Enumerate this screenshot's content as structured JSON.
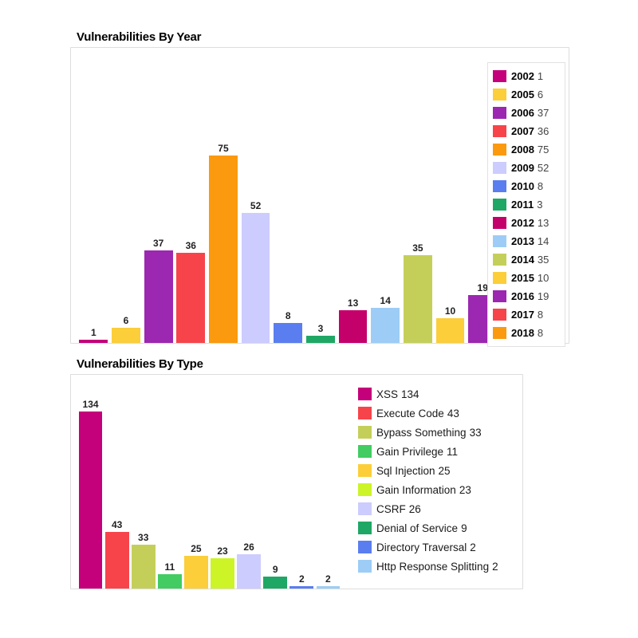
{
  "charts": [
    {
      "title": "Vulnerabilities By Year",
      "legend_style": "boxed",
      "legend_items": [
        {
          "key": "2002",
          "value": "1",
          "color": "#c4007a"
        },
        {
          "key": "2005",
          "value": "6",
          "color": "#fbce3a"
        },
        {
          "key": "2006",
          "value": "37",
          "color": "#9c27b0"
        },
        {
          "key": "2007",
          "value": "36",
          "color": "#f7444a"
        },
        {
          "key": "2008",
          "value": "75",
          "color": "#fb9a0e"
        },
        {
          "key": "2009",
          "value": "52",
          "color": "#ccccff"
        },
        {
          "key": "2010",
          "value": "8",
          "color": "#5a7ef0"
        },
        {
          "key": "2011",
          "value": "3",
          "color": "#1fa765"
        },
        {
          "key": "2012",
          "value": "13",
          "color": "#c4006b"
        },
        {
          "key": "2013",
          "value": "14",
          "color": "#9dcdf6"
        },
        {
          "key": "2014",
          "value": "35",
          "color": "#c4cf5a"
        },
        {
          "key": "2015",
          "value": "10",
          "color": "#fbce3a"
        },
        {
          "key": "2016",
          "value": "19",
          "color": "#9c27b0"
        },
        {
          "key": "2017",
          "value": "8",
          "color": "#f7444a"
        },
        {
          "key": "2018",
          "value": "8",
          "color": "#fb9a0e"
        }
      ]
    },
    {
      "title": "Vulnerabilities By Type",
      "legend_style": "plain",
      "legend_items": [
        {
          "key": "XSS",
          "value": "134",
          "color": "#c4007a"
        },
        {
          "key": "Execute Code",
          "value": "43",
          "color": "#f7444a"
        },
        {
          "key": "Bypass Something",
          "value": "33",
          "color": "#c4cf5a"
        },
        {
          "key": "Gain Privilege",
          "value": "11",
          "color": "#42cc62"
        },
        {
          "key": "Sql Injection",
          "value": "25",
          "color": "#fbce3a"
        },
        {
          "key": "Gain Information",
          "value": "23",
          "color": "#ccf427"
        },
        {
          "key": "CSRF",
          "value": "26",
          "color": "#ccccff"
        },
        {
          "key": "Denial of Service",
          "value": "9",
          "color": "#1fa765"
        },
        {
          "key": "Directory Traversal",
          "value": "2",
          "color": "#5a7ef0"
        },
        {
          "key": "Http Response Splitting",
          "value": "2",
          "color": "#9dcdf6"
        }
      ]
    }
  ],
  "chart_data": [
    {
      "type": "bar",
      "title": "Vulnerabilities By Year",
      "xlabel": "",
      "ylabel": "",
      "grid": false,
      "legend_position": "right",
      "ylim": [
        0,
        75
      ],
      "categories": [
        "2002",
        "2005",
        "2006",
        "2007",
        "2008",
        "2009",
        "2010",
        "2011",
        "2012",
        "2013",
        "2014",
        "2015",
        "2016",
        "2017",
        "2018"
      ],
      "values": [
        1,
        6,
        37,
        36,
        75,
        52,
        8,
        3,
        13,
        14,
        35,
        10,
        19,
        8,
        8
      ],
      "colors": [
        "#c4007a",
        "#fbce3a",
        "#9c27b0",
        "#f7444a",
        "#fb9a0e",
        "#ccccff",
        "#5a7ef0",
        "#1fa765",
        "#c4006b",
        "#9dcdf6",
        "#c4cf5a",
        "#fbce3a",
        "#9c27b0",
        "#f7444a",
        "#fb9a0e"
      ],
      "data_labels": [
        "1",
        "6",
        "37",
        "36",
        "75",
        "52",
        "8",
        "3",
        "13",
        "14",
        "35",
        "10",
        "19",
        "8",
        "8"
      ]
    },
    {
      "type": "bar",
      "title": "Vulnerabilities By Type",
      "xlabel": "",
      "ylabel": "",
      "grid": false,
      "legend_position": "right",
      "ylim": [
        0,
        134
      ],
      "categories": [
        "XSS",
        "Execute Code",
        "Bypass Something",
        "Gain Privilege",
        "Sql Injection",
        "Gain Information",
        "CSRF",
        "Denial of Service",
        "Directory Traversal",
        "Http Response Splitting"
      ],
      "values": [
        134,
        43,
        33,
        11,
        25,
        23,
        26,
        9,
        2,
        2
      ],
      "colors": [
        "#c4007a",
        "#f7444a",
        "#c4cf5a",
        "#42cc62",
        "#fbce3a",
        "#ccf427",
        "#ccccff",
        "#1fa765",
        "#5a7ef0",
        "#9dcdf6"
      ],
      "data_labels": [
        "134",
        "43",
        "33",
        "11",
        "25",
        "23",
        "26",
        "9",
        "2",
        "2"
      ]
    }
  ]
}
